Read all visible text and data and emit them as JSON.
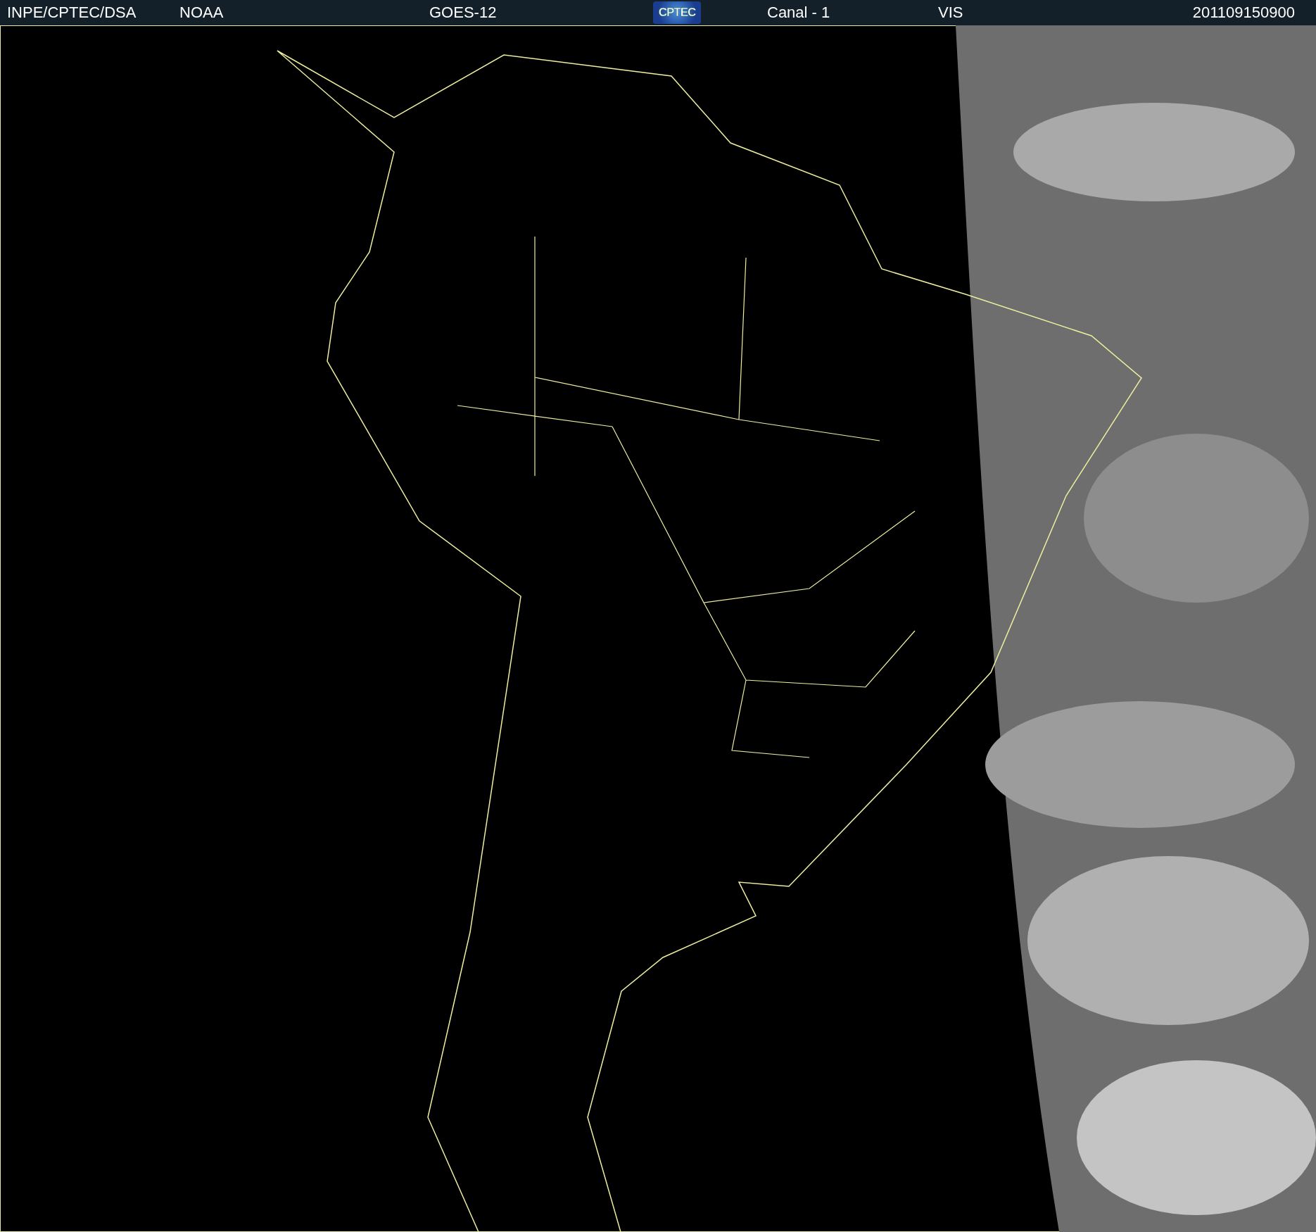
{
  "header": {
    "source": "INPE/CPTEC/DSA",
    "agency": "NOAA",
    "satellite": "GOES-12",
    "logo": "CPTEC",
    "channel": "Canal - 1",
    "band": "VIS",
    "timestamp": "201109150900"
  }
}
